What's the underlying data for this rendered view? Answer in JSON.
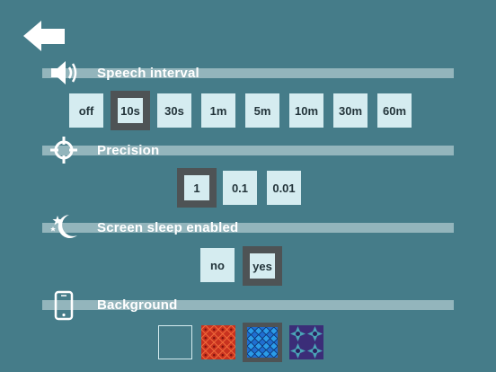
{
  "icons": {
    "back": "back-arrow-icon",
    "speaker": "speaker-icon",
    "crosshair": "crosshair-icon",
    "moon": "moon-stars-icon",
    "phone": "phone-icon"
  },
  "colors": {
    "background": "#457c89",
    "band": "#93b5bc",
    "option": "#d5ecf0",
    "selected_frame": "#4e5355"
  },
  "sections": {
    "speech": {
      "title": "Speech interval",
      "options": [
        "off",
        "10s",
        "30s",
        "1m",
        "5m",
        "10m",
        "30m",
        "60m"
      ],
      "selected": "10s"
    },
    "precision": {
      "title": "Precision",
      "options": [
        "1",
        "0.1",
        "0.01"
      ],
      "selected": "1"
    },
    "sleep": {
      "title": "Screen sleep enabled",
      "options": [
        "no",
        "yes"
      ],
      "selected": "yes"
    },
    "background": {
      "title": "Background",
      "options": [
        "plain",
        "red-pattern",
        "blue-pattern",
        "purple-star-pattern"
      ],
      "selected": "blue-pattern"
    }
  }
}
